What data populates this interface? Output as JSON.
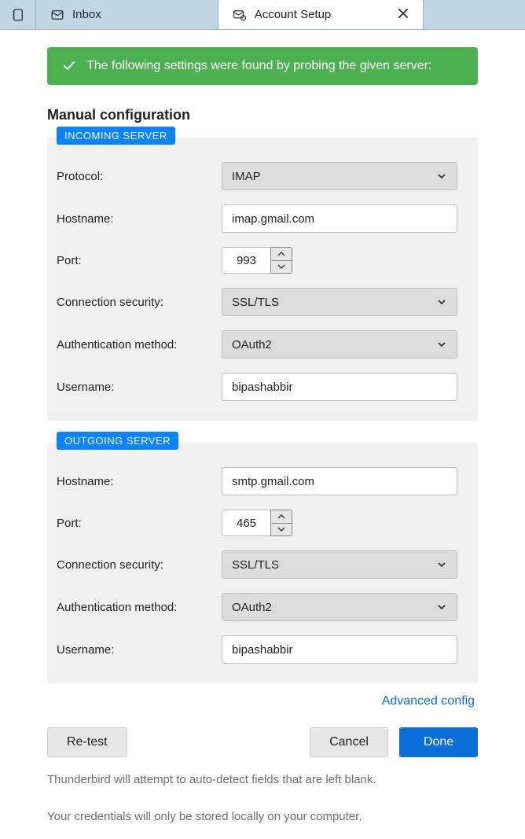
{
  "tabs": {
    "inbox": "Inbox",
    "account_setup": "Account Setup"
  },
  "alert": {
    "text": "The following settings were found by probing the given server:"
  },
  "heading": "Manual configuration",
  "incoming": {
    "badge": "INCOMING SERVER",
    "protocol_label": "Protocol:",
    "protocol_value": "IMAP",
    "hostname_label": "Hostname:",
    "hostname_value": "imap.gmail.com",
    "port_label": "Port:",
    "port_value": "993",
    "security_label": "Connection security:",
    "security_value": "SSL/TLS",
    "auth_label": "Authentication method:",
    "auth_value": "OAuth2",
    "username_label": "Username:",
    "username_value": "bipashabbir"
  },
  "outgoing": {
    "badge": "OUTGOING SERVER",
    "hostname_label": "Hostname:",
    "hostname_value": "smtp.gmail.com",
    "port_label": "Port:",
    "port_value": "465",
    "security_label": "Connection security:",
    "security_value": "SSL/TLS",
    "auth_label": "Authentication method:",
    "auth_value": "OAuth2",
    "username_label": "Username:",
    "username_value": "bipashabbir"
  },
  "advanced_link": "Advanced config",
  "buttons": {
    "retest": "Re-test",
    "cancel": "Cancel",
    "done": "Done"
  },
  "notes": {
    "n1": "Thunderbird will attempt to auto-detect fields that are left blank.",
    "n2": "Your credentials will only be stored locally on your computer."
  }
}
